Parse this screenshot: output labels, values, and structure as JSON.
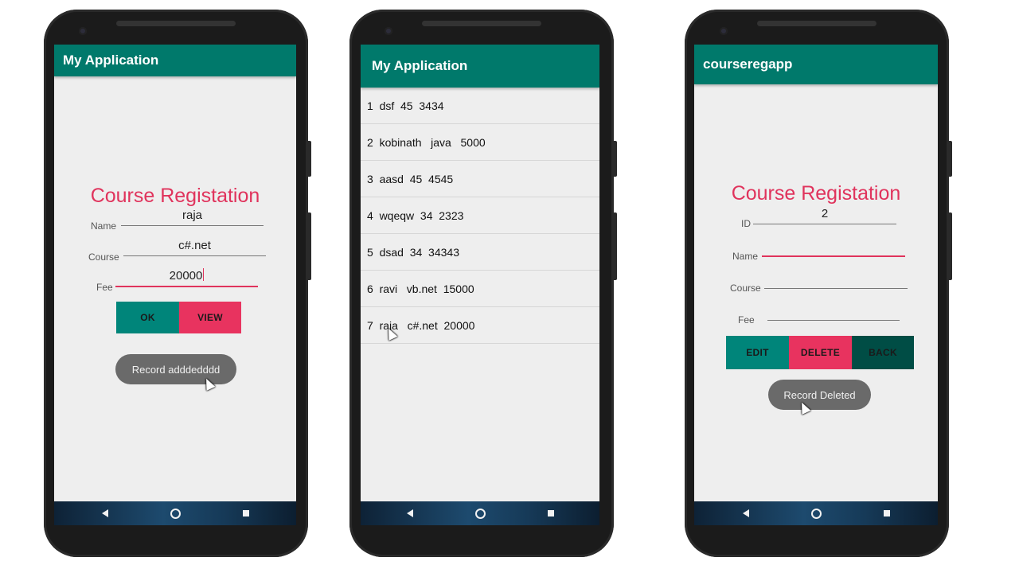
{
  "phone1": {
    "app_title": "My Application",
    "form_title": "Course Registation",
    "name_label": "Name",
    "name_value": "raja",
    "course_label": "Course",
    "course_value": "c#.net",
    "fee_label": "Fee",
    "fee_value": "20000",
    "ok_label": "OK",
    "view_label": "VIEW",
    "toast": "Record adddedddd"
  },
  "phone2": {
    "app_title": "My Application",
    "rows": [
      "1  dsf  45  3434",
      "2  kobinath   java   5000",
      "3  aasd  45  4545",
      "4  wqeqw  34  2323",
      "5  dsad  34  34343",
      "6  ravi   vb.net  15000",
      "7  raja   c#.net  20000"
    ]
  },
  "phone3": {
    "app_title": "courseregapp",
    "form_title": "Course Registation",
    "id_label": "ID",
    "id_value": "2",
    "name_label": "Name",
    "name_value": "",
    "course_label": "Course",
    "course_value": "",
    "fee_label": "Fee",
    "fee_value": "",
    "edit_label": "EDIT",
    "delete_label": "DELETE",
    "back_label": "BACK",
    "toast": "Record Deleted"
  },
  "colors": {
    "appbar": "#00796b",
    "accent": "#e0335c",
    "button_teal": "#00857a",
    "button_dark": "#004d45"
  }
}
